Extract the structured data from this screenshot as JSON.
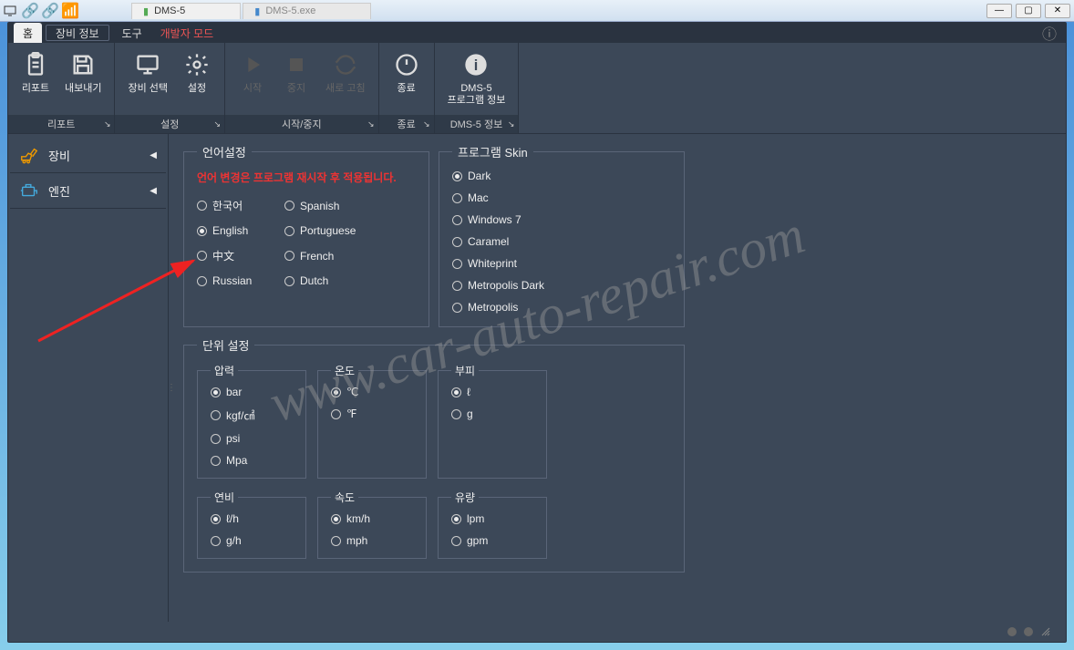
{
  "titlebar": {
    "tabs": [
      {
        "label": "DMS-5",
        "active": true
      },
      {
        "label": "DMS-5.exe",
        "active": false
      }
    ]
  },
  "menubar": {
    "tabs": [
      {
        "label": "홈",
        "key": "home",
        "active": true
      },
      {
        "label": "장비 정보",
        "key": "equip",
        "boxed": true
      },
      {
        "label": "도구",
        "key": "tools"
      },
      {
        "label": "개발자 모드",
        "key": "dev",
        "dev": true
      }
    ]
  },
  "ribbon": {
    "groups": [
      {
        "footer": "리포트",
        "items": [
          {
            "label": "리포트",
            "icon": "clipboard"
          },
          {
            "label": "내보내기",
            "icon": "save"
          }
        ]
      },
      {
        "footer": "설정",
        "items": [
          {
            "label": "장비 선택",
            "icon": "monitor"
          },
          {
            "label": "설정",
            "icon": "gear"
          }
        ]
      },
      {
        "footer": "시작/중지",
        "items": [
          {
            "label": "시작",
            "icon": "play",
            "disabled": true
          },
          {
            "label": "중지",
            "icon": "stop",
            "disabled": true
          },
          {
            "label": "새로 고침",
            "icon": "refresh",
            "disabled": true
          }
        ]
      },
      {
        "footer": "종료",
        "items": [
          {
            "label": "종료",
            "icon": "power"
          }
        ]
      },
      {
        "footer": "DMS-5 정보",
        "items": [
          {
            "label": "DMS-5\n프로그램 정보",
            "icon": "info"
          }
        ]
      }
    ]
  },
  "sidebar": {
    "items": [
      {
        "label": "장비",
        "icon": "excavator"
      },
      {
        "label": "엔진",
        "icon": "engine"
      }
    ]
  },
  "panels": {
    "language": {
      "title": "언어설정",
      "warning": "언어 변경은 프로그램 재시작 후 적용됩니다.",
      "options": [
        "한국어",
        "English",
        "中文",
        "Russian",
        "Spanish",
        "Portuguese",
        "French",
        "Dutch"
      ],
      "selected": "English"
    },
    "skin": {
      "title": "프로그램 Skin",
      "options": [
        "Dark",
        "Mac",
        "Windows 7",
        "Caramel",
        "Whiteprint",
        "Metropolis Dark",
        "Metropolis"
      ],
      "selected": "Dark"
    },
    "units": {
      "title": "단위 설정",
      "row1": [
        {
          "title": "압력",
          "options": [
            "bar",
            "kgf/㎠",
            "psi",
            "Mpa"
          ],
          "selected": "bar"
        },
        {
          "title": "온도",
          "options": [
            "℃",
            "℉"
          ],
          "selected": "℃"
        },
        {
          "title": "부피",
          "options": [
            "ℓ",
            "g"
          ],
          "selected": "ℓ"
        }
      ],
      "row2": [
        {
          "title": "연비",
          "options": [
            "ℓ/h",
            "g/h"
          ],
          "selected": "ℓ/h"
        },
        {
          "title": "속도",
          "options": [
            "km/h",
            "mph"
          ],
          "selected": "km/h"
        },
        {
          "title": "유량",
          "options": [
            "lpm",
            "gpm"
          ],
          "selected": "lpm"
        }
      ]
    }
  },
  "watermark": "www.car-auto-repair.com"
}
